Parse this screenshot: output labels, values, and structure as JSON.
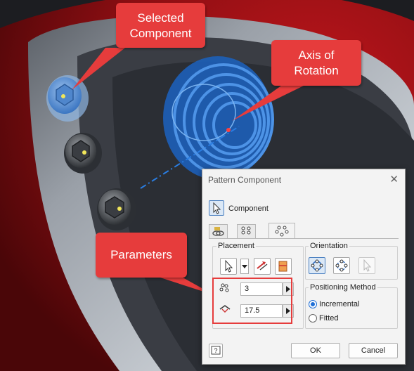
{
  "callouts": {
    "selected_component": [
      "Selected",
      "Component"
    ],
    "axis_of_rotation": [
      "Axis of",
      "Rotation"
    ],
    "parameters": "Parameters"
  },
  "dialog": {
    "title": "Pattern Component",
    "component_label": "Component",
    "tabs": [
      "associative-pattern-icon",
      "rectangular-pattern-icon",
      "circular-pattern-icon"
    ],
    "placement": {
      "label": "Placement",
      "count_value": "3",
      "angle_value": "17.5"
    },
    "orientation": {
      "label": "Orientation"
    },
    "positioning": {
      "label": "Positioning Method",
      "options": [
        "Incremental",
        "Fitted"
      ],
      "selected": "Incremental"
    },
    "ok_label": "OK",
    "cancel_label": "Cancel"
  },
  "colors": {
    "callout": "#e63c3c",
    "selection_blue": "#1f6fd6",
    "part_red": "#8c0f12"
  }
}
